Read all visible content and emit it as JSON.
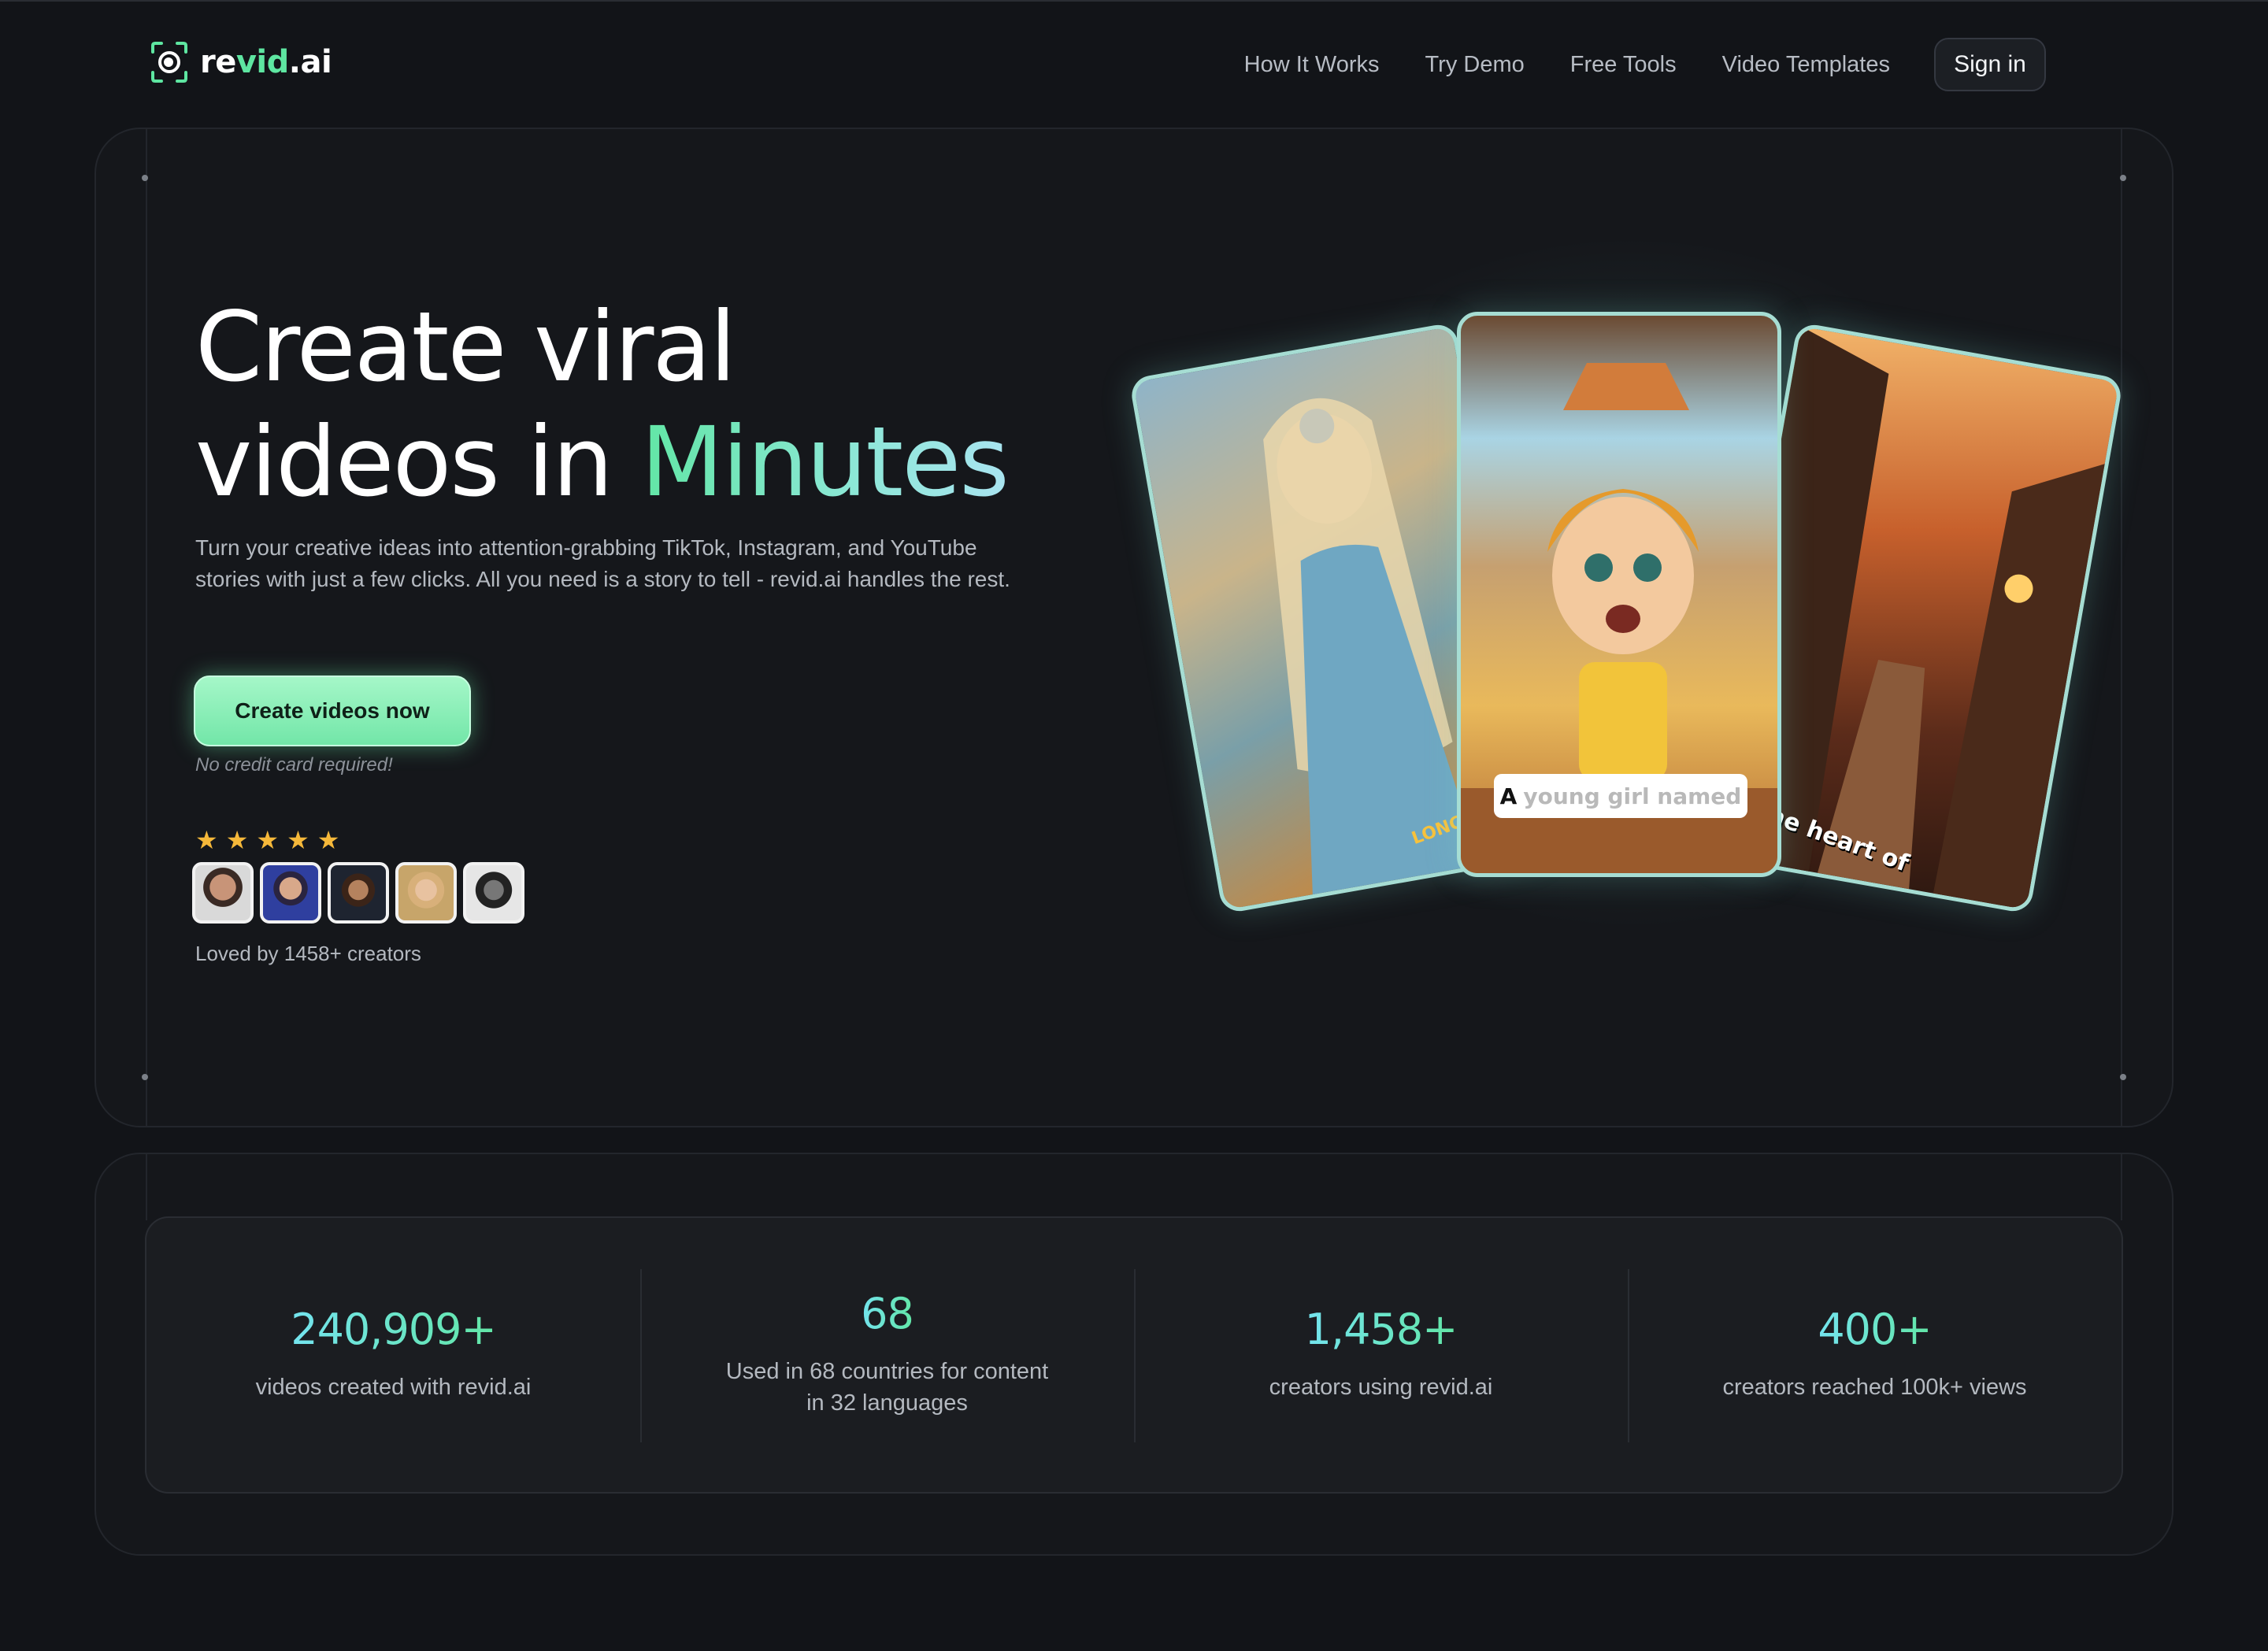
{
  "nav": {
    "logo_prefix": "re",
    "logo_accent": "vid",
    "logo_suffix": ".ai",
    "links": [
      "How It Works",
      "Try Demo",
      "Free Tools",
      "Video Templates"
    ],
    "signin_label": "Sign in"
  },
  "hero": {
    "headline_line1": "Create viral",
    "headline_line2_prefix": "videos in",
    "headline_accent": "Minutes",
    "subtitle": "Turn your creative ideas into attention-grabbing TikTok, Instagram, and YouTube stories with just a few clicks. All you need is a story to tell - revid.ai handles the rest.",
    "cta_label": "Create videos now",
    "cta_note": "No credit card required!",
    "rating_stars": 5,
    "loved_text": "Loved by 1458+ creators"
  },
  "cards": {
    "left_caption": "LONG",
    "mid_caption_bold": "A",
    "mid_caption_rest": "young girl named",
    "right_caption": "n the heart of"
  },
  "stats": [
    {
      "value": "240,909+",
      "label": "videos created with revid.ai"
    },
    {
      "value": "68",
      "label": "Used in 68 countries for content in 32 languages"
    },
    {
      "value": "1,458+",
      "label": "creators using revid.ai"
    },
    {
      "value": "400+",
      "label": "creators reached 100k+ views"
    }
  ],
  "colors": {
    "accent_green": "#62e6a6",
    "accent_cyan": "#74e4ef",
    "background": "#121418",
    "star": "#f5b83a"
  }
}
